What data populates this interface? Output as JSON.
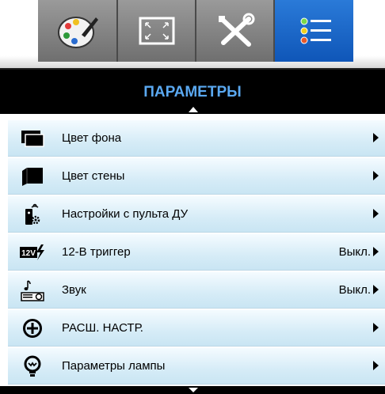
{
  "tabs": [
    {
      "name": "image",
      "icon": "palette-icon",
      "active": false
    },
    {
      "name": "display",
      "icon": "screen-resize-icon",
      "active": false
    },
    {
      "name": "setup",
      "icon": "tools-icon",
      "active": false
    },
    {
      "name": "options",
      "icon": "menu-list-icon",
      "active": true
    }
  ],
  "header": {
    "title": "ПАРАМЕТРЫ"
  },
  "menu": {
    "items": [
      {
        "label": "Цвет фона",
        "value": "",
        "icon": "background-color-icon"
      },
      {
        "label": "Цвет стены",
        "value": "",
        "icon": "wall-color-icon"
      },
      {
        "label": "Настройки с пульта ДУ",
        "value": "",
        "icon": "remote-settings-icon"
      },
      {
        "label": "12-В триггер",
        "value": "Выкл.",
        "icon": "12v-trigger-icon"
      },
      {
        "label": "Звук",
        "value": "Выкл.",
        "icon": "sound-icon"
      },
      {
        "label": "РАСШ. НАСТР.",
        "value": "",
        "icon": "advanced-icon"
      },
      {
        "label": "Параметры лампы",
        "value": "",
        "icon": "lamp-icon"
      }
    ]
  },
  "colors": {
    "active_tab": "#1a64c6",
    "title_text": "#5aa8f0",
    "row_bg": "#d6ecf7"
  }
}
